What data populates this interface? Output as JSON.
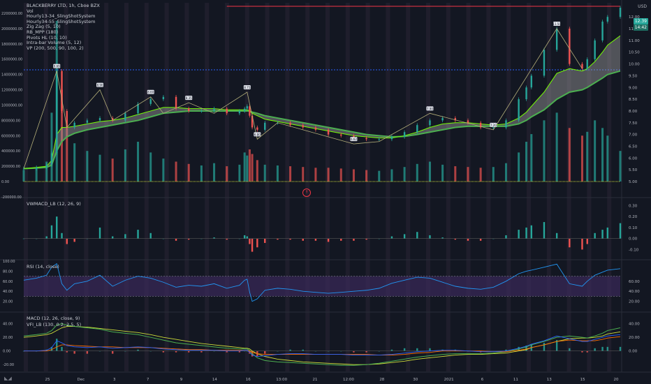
{
  "header": {
    "symbol_line": "BLACKBERRY LTD, 1h, Cboe BZX",
    "unit": "USD",
    "indicators": [
      "Vol",
      "Hourly13-34_SlingShotSystem",
      "Hourly34-55_SlingShotSystem",
      "Zig Zag (5, 10)",
      "RB_MPP (180)",
      "Pivots HL (10, 10)",
      "Intra-bar Volume (5, 12)",
      "VP (200, 500, 90, 100, 2)"
    ]
  },
  "price_tags": {
    "last_price": "12.39",
    "countdown": "14:42"
  },
  "panes": {
    "vwmacd": "VWMACD_LB (12, 26, 9)",
    "rsi": "RSI (14, close)",
    "macd": "MACD (12, 26, close, 9)",
    "vfi": "VFI_LB (130, 0.2, 2.5, 5)"
  },
  "marker": {
    "icon": "arrow-up-icon",
    "glyph": "↑"
  },
  "colors": {
    "background": "#131722",
    "bull": "#26a69a",
    "bear": "#ef5350",
    "green_line": "#4caf50",
    "red_line": "#e53935",
    "rsi_line": "#2196f3",
    "rsi_band": "#3b2a5a",
    "resistance": "#f23645"
  },
  "chart_data": [
    {
      "type": "line",
      "title": "BLACKBERRY LTD, 1h, Cboe BZX",
      "x_ticks": [
        "25",
        "Dec",
        "3",
        "7",
        "9",
        "14",
        "16",
        "13:00",
        "21",
        "12:00",
        "28",
        "30",
        "2021",
        "6",
        "11",
        "13",
        "15",
        "20"
      ],
      "y_right_ticks": [
        5.0,
        5.5,
        6.0,
        6.5,
        7.0,
        7.5,
        8.0,
        8.5,
        9.0,
        9.5,
        10.0,
        10.5,
        11.0,
        11.5,
        12.0
      ],
      "y_left_ticks": [
        "2200000.00",
        "2000000.00",
        "1800000.00",
        "1600000.00",
        "1400000.00",
        "1200000.00",
        "1000000.00",
        "800000.00",
        "600000.00",
        "400000.00",
        "200000.00",
        "0.00",
        "-200000.00"
      ],
      "ylim": [
        5.0,
        12.6
      ],
      "resistance_level": 12.45,
      "dotted_level": 9.75,
      "x": [
        0,
        5,
        9,
        11,
        13,
        15,
        17,
        20,
        25,
        30,
        35,
        40,
        45,
        50,
        55,
        60,
        65,
        70,
        75,
        80,
        85,
        87,
        88,
        89,
        90,
        92,
        95,
        100,
        105,
        110,
        115,
        120,
        125,
        130,
        135,
        140,
        145,
        150,
        155,
        160,
        165,
        170,
        175,
        180,
        185,
        190,
        195,
        198,
        200,
        205,
        210,
        215,
        220,
        222,
        225,
        228,
        230,
        235
      ],
      "close": [
        5.55,
        5.6,
        5.7,
        6.2,
        9.7,
        8.0,
        7.3,
        7.5,
        7.6,
        7.7,
        7.6,
        7.9,
        8.3,
        8.5,
        8.6,
        8.1,
        8.0,
        8.0,
        8.1,
        7.9,
        8.0,
        8.1,
        8.2,
        7.8,
        7.3,
        7.2,
        7.5,
        7.5,
        7.4,
        7.3,
        7.2,
        7.0,
        6.95,
        6.85,
        6.8,
        6.8,
        6.9,
        7.1,
        7.4,
        7.6,
        7.7,
        7.6,
        7.5,
        7.3,
        7.3,
        7.6,
        8.5,
        9.0,
        9.5,
        10.6,
        11.5,
        10.0,
        9.8,
        10.2,
        11.0,
        11.8,
        12.0,
        12.39
      ],
      "ma_fast": [
        5.55,
        5.6,
        5.65,
        5.9,
        7.0,
        7.3,
        7.3,
        7.35,
        7.45,
        7.55,
        7.6,
        7.7,
        7.85,
        8.0,
        8.15,
        8.15,
        8.1,
        8.1,
        8.1,
        8.05,
        8.05,
        8.05,
        8.05,
        8.0,
        7.9,
        7.8,
        7.65,
        7.55,
        7.45,
        7.35,
        7.25,
        7.15,
        7.05,
        6.95,
        6.9,
        6.85,
        6.85,
        6.95,
        7.1,
        7.3,
        7.45,
        7.5,
        7.5,
        7.45,
        7.4,
        7.45,
        7.7,
        7.95,
        8.2,
        8.8,
        9.6,
        9.8,
        9.7,
        9.8,
        10.1,
        10.5,
        10.8,
        11.2
      ],
      "ma_slow": [
        5.55,
        5.57,
        5.6,
        5.7,
        6.3,
        6.7,
        6.9,
        7.05,
        7.2,
        7.3,
        7.4,
        7.5,
        7.6,
        7.75,
        7.9,
        7.95,
        8.0,
        8.0,
        8.0,
        8.0,
        8.0,
        8.0,
        8.0,
        8.0,
        7.95,
        7.9,
        7.8,
        7.7,
        7.6,
        7.5,
        7.4,
        7.3,
        7.2,
        7.1,
        7.0,
        6.95,
        6.9,
        6.92,
        7.0,
        7.1,
        7.2,
        7.3,
        7.35,
        7.35,
        7.35,
        7.35,
        7.45,
        7.6,
        7.75,
        8.05,
        8.5,
        8.8,
        8.9,
        9.0,
        9.2,
        9.4,
        9.55,
        9.7
      ],
      "zigzag": [
        {
          "x": 0,
          "y": 5.55
        },
        {
          "x": 13,
          "y": 9.7
        },
        {
          "x": 17,
          "y": 7.3
        },
        {
          "x": 30,
          "y": 8.9
        },
        {
          "x": 35,
          "y": 7.6
        },
        {
          "x": 50,
          "y": 8.6
        },
        {
          "x": 55,
          "y": 7.9
        },
        {
          "x": 65,
          "y": 8.35
        },
        {
          "x": 75,
          "y": 7.9
        },
        {
          "x": 88,
          "y": 8.8
        },
        {
          "x": 92,
          "y": 6.8
        },
        {
          "x": 100,
          "y": 7.5
        },
        {
          "x": 130,
          "y": 6.6
        },
        {
          "x": 140,
          "y": 6.7
        },
        {
          "x": 160,
          "y": 7.9
        },
        {
          "x": 185,
          "y": 7.2
        },
        {
          "x": 210,
          "y": 11.5
        },
        {
          "x": 220,
          "y": 9.8
        }
      ],
      "pivot_labels": [
        {
          "x": 13,
          "y": 9.7,
          "text": "9.69"
        },
        {
          "x": 30,
          "y": 8.9,
          "text": "8.90"
        },
        {
          "x": 50,
          "y": 8.6,
          "text": "8.60"
        },
        {
          "x": 65,
          "y": 8.35,
          "text": "8.35"
        },
        {
          "x": 88,
          "y": 8.8,
          "text": "8.75"
        },
        {
          "x": 92,
          "y": 6.8,
          "text": "6.80"
        },
        {
          "x": 130,
          "y": 6.6,
          "text": "6.62"
        },
        {
          "x": 160,
          "y": 7.9,
          "text": "7.90"
        },
        {
          "x": 185,
          "y": 7.2,
          "text": "7.20"
        },
        {
          "x": 210,
          "y": 11.5,
          "text": "11.50"
        }
      ],
      "volume": [
        150000,
        180000,
        260000,
        900000,
        2100000,
        1200000,
        700000,
        500000,
        400000,
        350000,
        300000,
        420000,
        520000,
        380000,
        300000,
        260000,
        230000,
        210000,
        240000,
        200000,
        220000,
        380000,
        340000,
        420000,
        360000,
        280000,
        220000,
        210000,
        200000,
        190000,
        180000,
        180000,
        170000,
        160000,
        150000,
        140000,
        160000,
        190000,
        230000,
        260000,
        220000,
        200000,
        190000,
        180000,
        190000,
        240000,
        380000,
        520000,
        620000,
        800000,
        900000,
        700000,
        600000,
        650000,
        800000,
        700000,
        600000,
        400000
      ]
    },
    {
      "type": "bar",
      "title": "VWMACD_LB (12, 26, 9)",
      "y_ticks": [
        -0.1,
        0.0,
        0.1,
        0.2,
        0.3
      ],
      "ylim": [
        -0.18,
        0.36
      ],
      "x": [
        0,
        5,
        9,
        11,
        13,
        15,
        17,
        20,
        25,
        30,
        35,
        40,
        45,
        50,
        55,
        60,
        65,
        70,
        75,
        80,
        85,
        87,
        88,
        89,
        90,
        92,
        95,
        100,
        105,
        110,
        115,
        120,
        125,
        130,
        135,
        140,
        145,
        150,
        155,
        160,
        165,
        170,
        175,
        180,
        185,
        190,
        195,
        198,
        200,
        205,
        210,
        215,
        220,
        222,
        225,
        228,
        230,
        235
      ],
      "values": [
        0.0,
        0.0,
        0.02,
        0.12,
        0.2,
        0.05,
        -0.05,
        -0.03,
        0.0,
        0.1,
        0.02,
        0.04,
        0.08,
        0.05,
        0.0,
        -0.02,
        -0.01,
        0.0,
        0.01,
        -0.01,
        0.0,
        0.03,
        0.02,
        -0.05,
        -0.12,
        -0.08,
        -0.04,
        -0.01,
        -0.01,
        -0.02,
        -0.02,
        -0.03,
        -0.02,
        -0.02,
        -0.01,
        0.0,
        0.02,
        0.04,
        0.06,
        0.03,
        0.01,
        -0.01,
        -0.02,
        -0.02,
        0.0,
        0.03,
        0.08,
        0.1,
        0.12,
        0.15,
        0.05,
        -0.08,
        -0.1,
        -0.05,
        0.05,
        0.08,
        0.1,
        0.14
      ]
    },
    {
      "type": "line",
      "title": "RSI (14, close)",
      "y_ticks": [
        20.0,
        40.0,
        60.0
      ],
      "y_left_ticks": [
        "20.00",
        "40.00",
        "60.00",
        "80.00",
        "100.00"
      ],
      "ylim": [
        0,
        100
      ],
      "band": [
        30,
        70
      ],
      "x": [
        0,
        5,
        9,
        11,
        13,
        15,
        17,
        20,
        25,
        30,
        35,
        40,
        45,
        50,
        55,
        60,
        65,
        70,
        75,
        80,
        85,
        87,
        88,
        89,
        90,
        92,
        95,
        100,
        105,
        110,
        115,
        120,
        125,
        130,
        135,
        140,
        145,
        150,
        155,
        160,
        165,
        170,
        175,
        180,
        185,
        190,
        195,
        198,
        200,
        205,
        210,
        215,
        220,
        222,
        225,
        228,
        230,
        235
      ],
      "values": [
        62,
        66,
        72,
        88,
        95,
        55,
        42,
        55,
        60,
        72,
        50,
        62,
        70,
        66,
        58,
        48,
        52,
        50,
        55,
        46,
        52,
        62,
        64,
        38,
        20,
        25,
        42,
        46,
        44,
        40,
        38,
        36,
        38,
        40,
        42,
        46,
        56,
        62,
        68,
        66,
        58,
        50,
        46,
        44,
        48,
        60,
        75,
        80,
        82,
        88,
        94,
        55,
        50,
        60,
        72,
        78,
        82,
        85
      ]
    },
    {
      "type": "line",
      "title": "MACD (12, 26, close, 9)",
      "y_ticks": [
        0.0,
        20.0,
        40.0
      ],
      "y_left_ticks": [
        "-20.00",
        "0.00",
        "20.00",
        "40.00"
      ],
      "ylim": [
        -30,
        55
      ],
      "x": [
        0,
        5,
        9,
        11,
        13,
        15,
        17,
        20,
        25,
        30,
        35,
        40,
        45,
        50,
        55,
        60,
        65,
        70,
        75,
        80,
        85,
        87,
        88,
        89,
        90,
        92,
        95,
        100,
        105,
        110,
        115,
        120,
        125,
        130,
        135,
        140,
        145,
        150,
        155,
        160,
        165,
        170,
        175,
        180,
        185,
        190,
        195,
        198,
        200,
        205,
        210,
        215,
        220,
        222,
        225,
        228,
        230,
        235
      ],
      "macd": [
        0,
        0,
        1,
        5,
        15,
        12,
        8,
        6,
        5,
        6,
        4,
        5,
        6,
        5,
        3,
        2,
        1,
        1,
        1,
        0,
        0,
        1,
        1,
        -2,
        -6,
        -8,
        -7,
        -5,
        -4,
        -4,
        -5,
        -5,
        -5,
        -6,
        -6,
        -6,
        -5,
        -3,
        -1,
        0,
        1,
        1,
        0,
        -1,
        -1,
        0,
        4,
        7,
        10,
        15,
        22,
        18,
        14,
        14,
        17,
        20,
        22,
        24
      ],
      "signal": [
        0,
        0,
        0,
        2,
        6,
        9,
        9,
        8,
        7,
        6,
        6,
        5,
        5,
        5,
        4,
        3,
        2,
        2,
        1,
        1,
        1,
        1,
        1,
        0,
        -2,
        -4,
        -5,
        -5,
        -5,
        -5,
        -5,
        -5,
        -5,
        -5,
        -5,
        -6,
        -6,
        -5,
        -3,
        -2,
        0,
        0,
        0,
        0,
        -1,
        -1,
        1,
        3,
        5,
        9,
        14,
        16,
        15,
        15,
        15,
        17,
        19,
        21
      ],
      "vfi": [
        22,
        24,
        26,
        30,
        38,
        40,
        38,
        36,
        34,
        32,
        28,
        26,
        24,
        20,
        16,
        12,
        10,
        8,
        6,
        4,
        3,
        3,
        3,
        1,
        -4,
        -10,
        -14,
        -16,
        -17,
        -18,
        -19,
        -20,
        -21,
        -21,
        -20,
        -18,
        -15,
        -12,
        -9,
        -7,
        -5,
        -4,
        -4,
        -4,
        -3,
        -1,
        3,
        6,
        9,
        14,
        20,
        22,
        20,
        19,
        22,
        26,
        30,
        34
      ],
      "vfi_signal": [
        20,
        22,
        24,
        26,
        30,
        34,
        36,
        36,
        35,
        33,
        31,
        29,
        27,
        24,
        20,
        17,
        14,
        11,
        9,
        7,
        5,
        4,
        4,
        3,
        0,
        -4,
        -8,
        -12,
        -14,
        -16,
        -17,
        -18,
        -19,
        -20,
        -20,
        -19,
        -17,
        -15,
        -12,
        -10,
        -8,
        -6,
        -5,
        -5,
        -4,
        -3,
        0,
        2,
        5,
        9,
        14,
        18,
        19,
        19,
        20,
        22,
        25,
        28
      ]
    }
  ]
}
